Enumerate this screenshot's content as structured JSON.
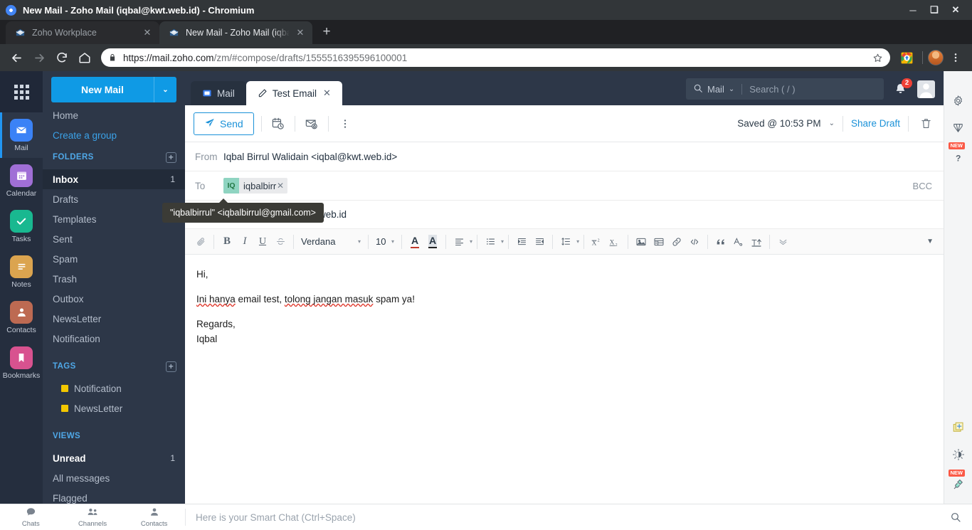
{
  "window": {
    "title": "New Mail - Zoho Mail (iqbal@kwt.web.id) - Chromium",
    "minimize": "─",
    "maximize": "❑",
    "close": "✕"
  },
  "browser": {
    "tabs": [
      {
        "label": "Zoho Workplace",
        "close": "✕",
        "active": false
      },
      {
        "label": "New Mail - Zoho Mail (iqbal@kw",
        "close": "✕",
        "active": true
      }
    ],
    "new_tab": "+",
    "back_icon": "back-arrow",
    "forward_icon": "forward-arrow",
    "reload_icon": "reload",
    "home_icon": "home",
    "url_secure": "https://mail.zoho.com",
    "url_path": "/zm/#compose/drafts/1555516395596100001",
    "bookmark_icon": "star",
    "extension_icon": "extension",
    "menu_icon": "three-dot-menu"
  },
  "rail": {
    "apps_icon": "grid-apps",
    "items": [
      {
        "label": "Mail",
        "color": "#3b82f6",
        "selected": true
      },
      {
        "label": "Calendar",
        "color": "#a06fd6",
        "selected": false
      },
      {
        "label": "Tasks",
        "color": "#19b890",
        "selected": false
      },
      {
        "label": "Notes",
        "color": "#dba44f",
        "selected": false
      },
      {
        "label": "Contacts",
        "color": "#bd6a52",
        "selected": false
      },
      {
        "label": "Bookmarks",
        "color": "#d8528f",
        "selected": false
      }
    ],
    "collapse_icon": "collapse-sidebar"
  },
  "sidebar": {
    "new_mail": "New Mail",
    "new_mail_caret": "⌄",
    "home": "Home",
    "create_group": "Create a group",
    "folders_header": "FOLDERS",
    "tags_header": "TAGS",
    "views_header": "VIEWS",
    "add_icon": "+",
    "folders": [
      {
        "label": "Inbox",
        "count": "1",
        "selected": true
      },
      {
        "label": "Drafts",
        "count": "",
        "selected": false
      },
      {
        "label": "Templates",
        "count": "",
        "selected": false
      },
      {
        "label": "Sent",
        "count": "",
        "selected": false
      },
      {
        "label": "Spam",
        "count": "",
        "selected": false
      },
      {
        "label": "Trash",
        "count": "",
        "selected": false
      },
      {
        "label": "Outbox",
        "count": "",
        "selected": false
      },
      {
        "label": "NewsLetter",
        "count": "",
        "selected": false
      },
      {
        "label": "Notification",
        "count": "",
        "selected": false
      }
    ],
    "tags": [
      {
        "label": "Notification",
        "color": "#f3c700"
      },
      {
        "label": "NewsLetter",
        "color": "#f3c700"
      }
    ],
    "views": [
      {
        "label": "Unread",
        "count": "1",
        "selected": true
      },
      {
        "label": "All messages",
        "count": "",
        "selected": false
      },
      {
        "label": "Flagged",
        "count": "",
        "selected": false
      }
    ]
  },
  "topbar": {
    "tabs": [
      {
        "label": "Mail",
        "icon": "mail-icon",
        "active": false,
        "closable": false
      },
      {
        "label": "Test Email",
        "icon": "pencil-icon",
        "active": true,
        "closable": true,
        "close": "✕"
      }
    ],
    "search_scope": "Mail",
    "search_caret": "⌄",
    "search_placeholder": "Search ( / )",
    "search_icon": "search-icon",
    "bell_icon": "bell-icon",
    "notification_count": "2",
    "avatar": "user-avatar"
  },
  "compose": {
    "send_label": "Send",
    "send_icon": "paper-plane-icon",
    "schedule_icon": "schedule-send-icon",
    "template_icon": "insert-template-icon",
    "more_icon": "more-options-icon",
    "saved_status": "Saved @ 10:53 PM",
    "saved_caret": "⌄",
    "share_draft": "Share Draft",
    "delete_icon": "trash-icon",
    "from_label": "From",
    "from_value": "Iqbal Birrul Walidain <iqbal@kwt.web.id>",
    "to_label": "To",
    "recipient_initials": "IQ",
    "recipient_name": "iqbalbirrul",
    "recipient_remove": "✕",
    "bcc_label": "BCC",
    "tooltip": "\"iqbalbirrul\" <iqbalbirrul@gmail.com>",
    "subject": "Test Email Zoho | iqbal@kwt.web.id"
  },
  "format_toolbar": {
    "font_family": "Verdana",
    "font_size": "10",
    "caret": "▾",
    "small_caret": "▾",
    "expand": "▼",
    "icons": {
      "attach": "paperclip-icon",
      "bold": "B",
      "italic": "I",
      "underline": "U",
      "strikethrough": "strikethrough-icon",
      "text_color": "A",
      "highlight": "highlight-color-icon",
      "align": "align-left-icon",
      "bullet_list": "bullet-list-icon",
      "indent": "indent-icon",
      "outdent": "outdent-icon",
      "line_spacing": "line-spacing-icon",
      "superscript": "superscript-icon",
      "subscript": "subscript-icon",
      "image": "insert-image-icon",
      "table": "insert-table-icon",
      "link": "insert-link-icon",
      "code": "code-icon",
      "quote": "blockquote-icon",
      "clear_format": "clear-formatting-icon",
      "signature": "signature-icon",
      "more": "more-format-icon"
    }
  },
  "body": {
    "greeting": "Hi,",
    "line_1_part_1": "Ini hanya",
    "line_1_part_2": " email test, ",
    "line_1_part_3": "tolong jangan masuk",
    "line_1_part_4": " spam ya!",
    "signoff_1": "Regards,",
    "signoff_2": "Iqbal"
  },
  "right_rail": {
    "items": [
      {
        "name": "settings-gear-icon",
        "badge": ""
      },
      {
        "name": "zoho-v-icon",
        "badge": ""
      },
      {
        "name": "help-question-icon",
        "badge": "NEW"
      },
      {
        "name": "add-note-icon",
        "badge": ""
      },
      {
        "name": "theme-brightness-icon",
        "badge": ""
      },
      {
        "name": "plugin-icon",
        "badge": "NEW"
      },
      {
        "name": "chat-comment-icon",
        "badge": ""
      }
    ]
  },
  "bottom_bar": {
    "items": [
      {
        "label": "Chats",
        "icon": "chat-bubble-icon"
      },
      {
        "label": "Channels",
        "icon": "channels-icon"
      },
      {
        "label": "Contacts",
        "icon": "contact-person-icon"
      }
    ],
    "smart_chat_placeholder": "Here is your Smart Chat (Ctrl+Space)",
    "search_icon": "search-icon"
  }
}
